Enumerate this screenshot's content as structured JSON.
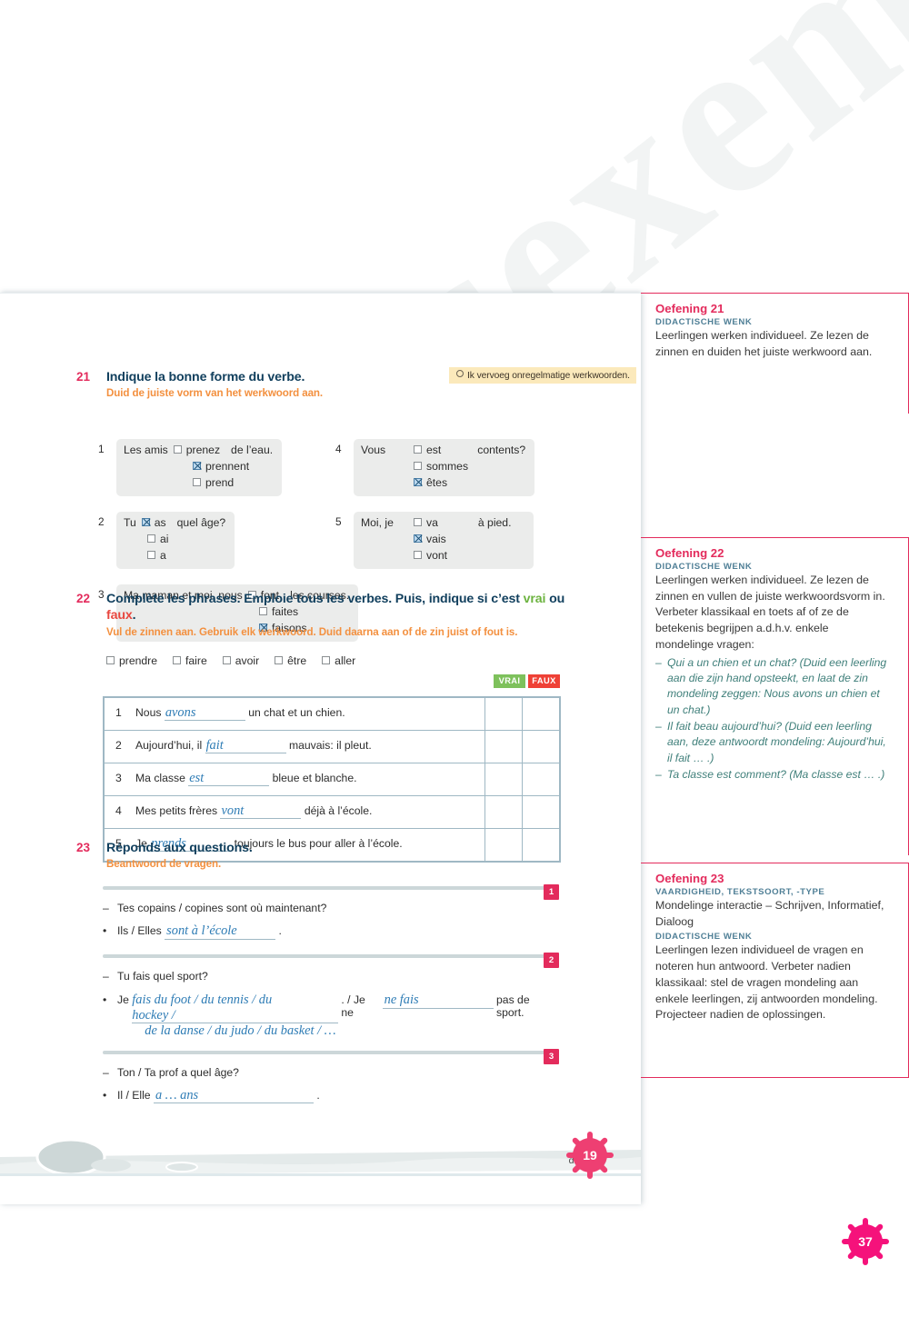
{
  "watermark": {
    "text": "Leesexemplaar"
  },
  "exercises": [
    {
      "number": "21",
      "title": "Indique la bonne forme du verbe.",
      "subtitle": "Duid de juiste vorm van het werkwoord aan.",
      "tip": "Ik vervoeg onregelmatige werkwoorden.",
      "items": [
        {
          "n": "1",
          "subject": "Les amis",
          "options": [
            "prenez",
            "prennent",
            "prend"
          ],
          "checked": 1,
          "tail": "de l’eau."
        },
        {
          "n": "2",
          "subject": "Tu",
          "options": [
            "as",
            "ai",
            "a"
          ],
          "checked": 0,
          "tail": "quel âge?"
        },
        {
          "n": "3",
          "subject": "Ma maman et moi, nous",
          "options": [
            "font",
            "faites",
            "faisons"
          ],
          "checked": 2,
          "tail": "les courses."
        },
        {
          "n": "4",
          "subject": "Vous",
          "options": [
            "est",
            "sommes",
            "êtes"
          ],
          "checked": 2,
          "tail": "contents?"
        },
        {
          "n": "5",
          "subject": "Moi, je",
          "options": [
            "va",
            "vais",
            "vont"
          ],
          "checked": 1,
          "tail": "à pied."
        }
      ]
    },
    {
      "number": "22",
      "title_parts": {
        "main": "Complète les phrases. Emploie tous les verbes. Puis, indique si c’est ",
        "vrai": "vrai",
        "ou": " ou ",
        "faux": "faux",
        "end": "."
      },
      "subtitle": "Vul de zinnen aan. Gebruik elk werkwoord. Duid daarna aan of de zin juist of fout is.",
      "verbs": [
        "prendre",
        "faire",
        "avoir",
        "être",
        "aller"
      ],
      "col_headers": {
        "vrai": "VRAI",
        "faux": "FAUX"
      },
      "rows": [
        {
          "n": "1",
          "before": "Nous",
          "answer": "avons",
          "after": "un chat et un chien."
        },
        {
          "n": "2",
          "before": "Aujourd’hui, il",
          "answer": "fait",
          "after": "mauvais: il pleut."
        },
        {
          "n": "3",
          "before": "Ma classe",
          "answer": "est",
          "after": "bleue et blanche."
        },
        {
          "n": "4",
          "before": "Mes petits frères",
          "answer": "vont",
          "after": "déjà à l’école."
        },
        {
          "n": "5",
          "before": "Je",
          "answer": "prends",
          "after": "toujours le bus pour aller à l’école."
        }
      ]
    },
    {
      "number": "23",
      "title": "Réponds aux questions.",
      "subtitle": "Beantwoord de vragen.",
      "blocks": [
        {
          "badge": "1",
          "question": "Tes copains / copines sont où maintenant?",
          "answer_prefix": "Ils / Elles",
          "answer": "sont à l’école",
          "answer_suffix": "."
        },
        {
          "badge": "2",
          "question": "Tu fais quel sport?",
          "answer_prefix": "Je",
          "answer_line1": "fais du foot / du tennis / du hockey /",
          "answer_line2": "de la danse / du judo / du basket / …",
          "mid": ". / Je ne",
          "answer2": "ne fais",
          "answer_suffix": "pas de sport."
        },
        {
          "badge": "3",
          "question": "Ton / Ta prof a quel âge?",
          "answer_prefix": "Il / Elle",
          "answer": "a … ans",
          "answer_suffix": "."
        }
      ]
    }
  ],
  "footer": {
    "page_word": "dix-neuf",
    "page_badge": "19"
  },
  "teacher_notes": [
    {
      "title": "Oefening 21",
      "kicker": "DIDACTISCHE WENK",
      "body": "Leerlingen werken individueel. Ze lezen de zinnen en duiden het juiste werkwoord aan."
    },
    {
      "title": "Oefening 22",
      "kicker": "DIDACTISCHE WENK",
      "body": "Leerlingen werken individueel. Ze lezen de zinnen en vullen de juiste werkwoordsvorm in. Verbeter klassikaal en toets af of ze de betekenis begrijpen a.d.h.v. enkele mondelinge vragen:",
      "bullets": [
        "Qui a un chien et un chat? (Duid een leerling aan die zijn hand opsteekt, en laat de zin mondeling zeggen: Nous avons un chien et un chat.)",
        "Il fait beau aujourd’hui? (Duid een leerling aan, deze antwoordt mondeling: Aujourd’hui, il fait … .)",
        "Ta classe est comment? (Ma classe est … .)"
      ]
    },
    {
      "title": "Oefening 23",
      "kicker": "VAARDIGHEID, TEKSTSOORT, -TYPE",
      "body": "Mondelinge interactie – Schrijven, Informatief, Dialoog",
      "kicker2": "DIDACTISCHE WENK",
      "body2": "Leerlingen lezen individueel de vragen en noteren hun antwoord. Verbeter nadien klassikaal: stel de vragen mondeling aan enkele leerlingen, zij antwoorden mondeling. Projecteer nadien de oplossingen."
    }
  ],
  "spread_badge": "37",
  "colors": {
    "accent_pink": "#e32b5c",
    "title_blue": "#12405e",
    "sub_orange": "#f3903f",
    "answer_blue": "#2e7cb5",
    "vrai_green": "#7ec15c",
    "faux_red": "#ef4136",
    "tip_yellow": "#fbe9bb"
  }
}
